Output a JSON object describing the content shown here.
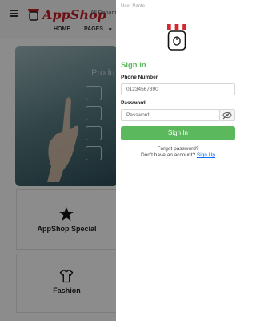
{
  "app": {
    "logo_text": "AppShop",
    "departments_label": "All Departm",
    "nav": [
      "HOME",
      "PAGES"
    ],
    "hero_word": "Produ",
    "cards": [
      "AppShop Special",
      "Fashion"
    ]
  },
  "drawer": {
    "header": "User Pante",
    "title": "Sign In",
    "phone_label": "Phone Number",
    "phone_value": "01234567890",
    "password_label": "Password",
    "password_placeholder": "Password",
    "signin_button": "Sign In",
    "forgot_text": "Forgot password?",
    "no_account_text": "Don't have an account?",
    "signup_link": "Sign Up"
  },
  "icons": [
    "menu-icon",
    "shop-awning-icon",
    "star-icon",
    "shirt-icon",
    "eye-slash-icon"
  ],
  "colors": {
    "accent": "#5cb85c",
    "brand": "#c81d25",
    "link": "#0d6efd"
  }
}
